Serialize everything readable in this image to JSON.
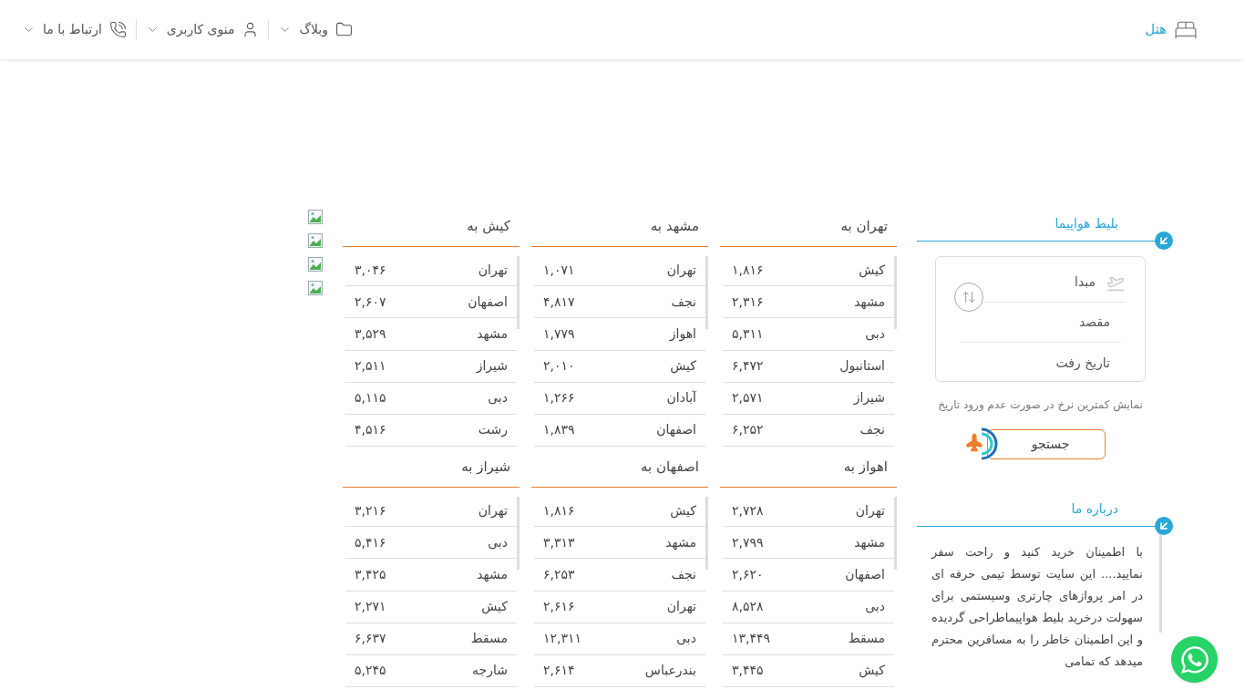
{
  "header": {
    "brand": "هتل",
    "menus": [
      {
        "label": "وبلاگ",
        "kind": "folder"
      },
      {
        "label": "منوی کاربری",
        "kind": "user"
      },
      {
        "label": "ارتباط با ما",
        "kind": "phone"
      }
    ]
  },
  "flight_search": {
    "title": "بلیط هواپیما",
    "origin": {
      "placeholder": "مبدا"
    },
    "destination": {
      "placeholder": "مقصد"
    },
    "date": {
      "placeholder": "تاریخ رفت"
    },
    "note": "نمایش کمترین نرخ در صورت عدم ورود تاریخ",
    "button": "جستجو"
  },
  "about": {
    "title": "درباره ما",
    "text": "با اطمینان خرید کنید و راحت سفر نمایید.... این سایت توسط تیمی حرفه ای در امر پروازهای چارتری وسیستمی برای سهولت درخرید بلیط هواپیماطراحی گردیده و این اطمینان خاطر را به مسافرین محترم میدهد که تمامی"
  },
  "route_tables": [
    {
      "title": "تهران به",
      "rows": [
        {
          "city": "کیش",
          "price": "۱,۸۱۶"
        },
        {
          "city": "مشهد",
          "price": "۲,۳۱۶"
        },
        {
          "city": "دبی",
          "price": "۵,۳۱۱"
        },
        {
          "city": "استانبول",
          "price": "۶,۴۷۲"
        },
        {
          "city": "شیراز",
          "price": "۲,۵۷۱"
        },
        {
          "city": "نجف",
          "price": "۶,۲۵۲"
        }
      ]
    },
    {
      "title": "مشهد به",
      "rows": [
        {
          "city": "تهران",
          "price": "۱,۰۷۱"
        },
        {
          "city": "نجف",
          "price": "۴,۸۱۷"
        },
        {
          "city": "اهواز",
          "price": "۱,۷۷۹"
        },
        {
          "city": "کیش",
          "price": "۲,۰۱۰"
        },
        {
          "city": "آبادان",
          "price": "۱,۲۶۶"
        },
        {
          "city": "اصفهان",
          "price": "۱,۸۳۹"
        }
      ]
    },
    {
      "title": "کیش به",
      "rows": [
        {
          "city": "تهران",
          "price": "۳,۰۴۶"
        },
        {
          "city": "اصفهان",
          "price": "۲,۶۰۷"
        },
        {
          "city": "مشهد",
          "price": "۳,۵۲۹"
        },
        {
          "city": "شیراز",
          "price": "۲,۵۱۱"
        },
        {
          "city": "دبی",
          "price": "۵,۱۱۵"
        },
        {
          "city": "رشت",
          "price": "۴,۵۱۶"
        }
      ]
    },
    {
      "title": "اهواز به",
      "rows": [
        {
          "city": "تهران",
          "price": "۲,۷۲۸"
        },
        {
          "city": "مشهد",
          "price": "۲,۷۹۹"
        },
        {
          "city": "اصفهان",
          "price": "۲,۶۲۰"
        },
        {
          "city": "دبی",
          "price": "۸,۵۲۸"
        },
        {
          "city": "مسقط",
          "price": "۱۳,۴۴۹"
        },
        {
          "city": "کیش",
          "price": "۳,۴۴۵"
        }
      ]
    },
    {
      "title": "اصفهان به",
      "rows": [
        {
          "city": "کیش",
          "price": "۱,۸۱۶"
        },
        {
          "city": "مشهد",
          "price": "۳,۳۱۳"
        },
        {
          "city": "نجف",
          "price": "۶,۲۵۳"
        },
        {
          "city": "تهران",
          "price": "۲,۶۱۶"
        },
        {
          "city": "دبی",
          "price": "۱۲,۳۱۱"
        },
        {
          "city": "بندرعباس",
          "price": "۲,۶۱۴"
        }
      ]
    },
    {
      "title": "شیراز به",
      "rows": [
        {
          "city": "تهران",
          "price": "۳,۲۱۶"
        },
        {
          "city": "دبی",
          "price": "۵,۴۱۶"
        },
        {
          "city": "مشهد",
          "price": "۳,۴۲۵"
        },
        {
          "city": "کیش",
          "price": "۲,۲۷۱"
        },
        {
          "city": "مسقط",
          "price": "۶,۶۳۷"
        },
        {
          "city": "شارجه",
          "price": "۵,۲۴۵"
        }
      ]
    }
  ],
  "side_images": [
    {
      "kind": "broken-image"
    },
    {
      "kind": "broken-image"
    },
    {
      "kind": "broken-image"
    },
    {
      "kind": "broken-image"
    }
  ]
}
